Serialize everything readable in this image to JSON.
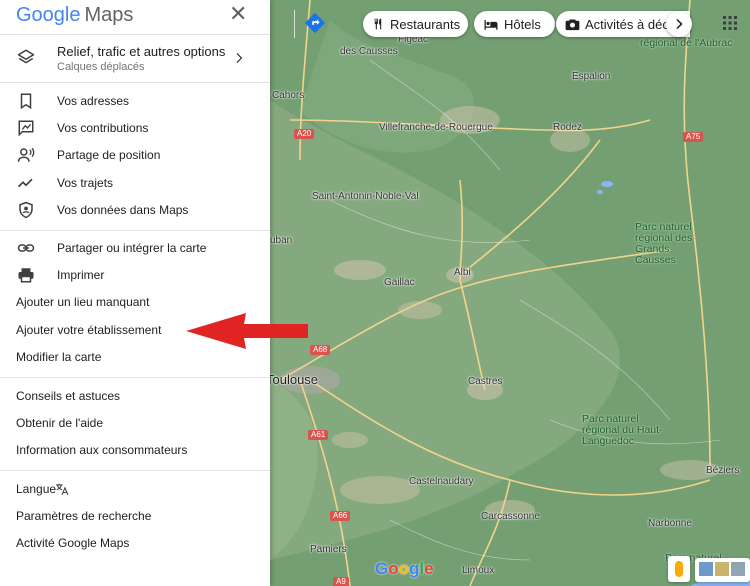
{
  "header": {
    "logo_google": "Google",
    "logo_maps": "Maps",
    "close_label": "✕"
  },
  "layers": {
    "title": "Relief, trafic et autres options",
    "subtitle": "Calques déplacés"
  },
  "menu_section1": [
    {
      "label": "Vos adresses",
      "icon": "bookmark-icon"
    },
    {
      "label": "Vos contributions",
      "icon": "contributions-icon"
    },
    {
      "label": "Partage de position",
      "icon": "location-sharing-icon"
    },
    {
      "label": "Vos trajets",
      "icon": "timeline-icon"
    },
    {
      "label": "Vos données dans Maps",
      "icon": "shield-icon"
    }
  ],
  "menu_section2": [
    {
      "label": "Partager ou intégrer la carte",
      "icon": "link-icon"
    },
    {
      "label": "Imprimer",
      "icon": "printer-icon"
    },
    {
      "label": "Ajouter un lieu manquant"
    },
    {
      "label": "Ajouter votre établissement"
    },
    {
      "label": "Modifier la carte"
    }
  ],
  "menu_section3": [
    {
      "label": "Conseils et astuces"
    },
    {
      "label": "Obtenir de l'aide"
    },
    {
      "label": "Information aux consommateurs"
    }
  ],
  "menu_section4": [
    {
      "label": "Langue",
      "icon": "translate-icon"
    },
    {
      "label": "Paramètres de recherche"
    },
    {
      "label": "Activité Google Maps"
    }
  ],
  "chips": [
    {
      "label": "Restaurants",
      "icon": "fork-knife-icon"
    },
    {
      "label": "Hôtels",
      "icon": "bed-icon"
    },
    {
      "label": "Activités à déc",
      "icon": "camera-icon"
    }
  ],
  "map": {
    "places": [
      "Figeac",
      "Cahors",
      "Villefranche-de-Rouergue",
      "Rodez",
      "Espalion",
      "Saint-Antonin-Noble-Val",
      "Gaillac",
      "Albi",
      "Castres",
      "Castelnaudary",
      "Carcassonne",
      "Narbonne",
      "Béziers",
      "Pamiers",
      "Limoux",
      "Toulouse",
      "uban",
      "des Causses"
    ],
    "parks": [
      "régional de l'Aubrac",
      "Parc naturel régional des Grands Causses",
      "Parc naturel régional du Haut-Languedoc",
      "Parc naturel"
    ],
    "roads": [
      "A20",
      "A68",
      "A61",
      "A66",
      "A75",
      "A9"
    ],
    "google_mark": "Google"
  },
  "colors": {
    "map_green": "#739f72",
    "arrow_red": "#e02424"
  }
}
